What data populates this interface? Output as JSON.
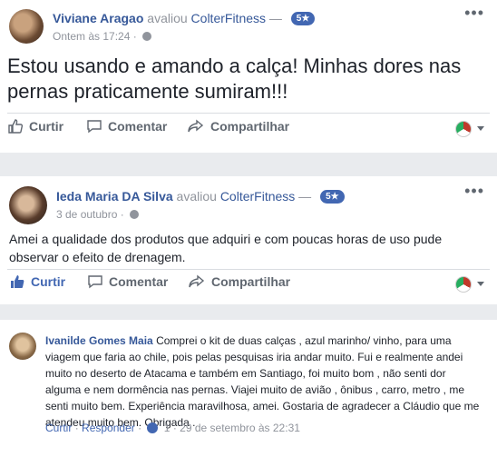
{
  "review1": {
    "author": "Viviane Aragao",
    "verb": "avaliou",
    "page": "ColterFitness",
    "dash": "—",
    "rating": "5★",
    "timestamp": "Ontem às 17:24",
    "separator": "·",
    "text": "Estou usando e amando a calça! Minhas dores nas pernas praticamente sumiram!!!",
    "actions": {
      "like": "Curtir",
      "comment": "Comentar",
      "share": "Compartilhar"
    }
  },
  "review2": {
    "author": "Ieda Maria DA Silva",
    "verb": "avaliou",
    "page": "ColterFitness",
    "dash": "—",
    "rating": "5★",
    "timestamp": "3 de outubro",
    "separator": "·",
    "text": "Amei a qualidade dos produtos que adquiri e com poucas horas de uso pude observar o efeito de drenagem.",
    "actions": {
      "like": "Curtir",
      "comment": "Comentar",
      "share": "Compartilhar"
    }
  },
  "comment": {
    "author": "Ivanilde Gomes Maia",
    "text": "Comprei o kit de duas calças , azul marinho/ vinho, para uma viagem que faria ao chile, pois pelas pesquisas iria andar muito. Fui e realmente andei muito no deserto de Atacama e também em Santiago, foi muito bom , não senti dor alguma e nem dormência nas pernas. Viajei muito de avião , ônibus , carro, metro , me senti muito bem. Experiência maravilhosa, amei. Gostaria de agradecer a Cláudio que me atendeu muito bem. Obrigada .",
    "like": "Curtir",
    "reply": "Responder",
    "like_count": "1",
    "timestamp": "29 de setembro às 22:31",
    "separator": "·"
  },
  "colors": {
    "link": "#365899",
    "accent": "#4267b2",
    "muted": "#90949c",
    "background": "#e9ebee"
  }
}
